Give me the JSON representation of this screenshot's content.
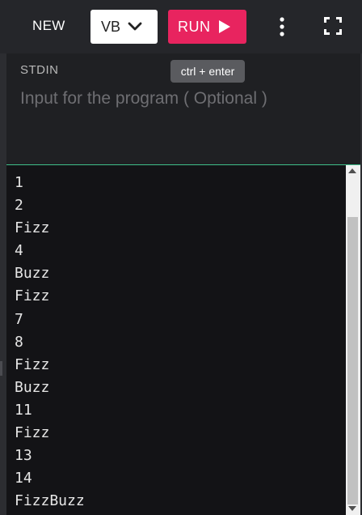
{
  "toolbar": {
    "new_label": "NEW",
    "language": "VB",
    "run_label": "RUN",
    "icons": [
      "chevron-down-icon",
      "play-icon",
      "more-vertical-icon",
      "fullscreen-icon"
    ]
  },
  "tooltip": {
    "text": "ctrl + enter"
  },
  "stdin": {
    "title": "STDIN",
    "value": "",
    "placeholder": "Input for the program ( Optional )"
  },
  "output": {
    "lines": [
      "1",
      "2",
      "Fizz",
      "4",
      "Buzz",
      "Fizz",
      "7",
      "8",
      "Fizz",
      "Buzz",
      "11",
      "Fizz",
      "13",
      "14",
      "FizzBuzz"
    ]
  },
  "colors": {
    "run_button": "#e8245f",
    "divider": "#3fbf8a",
    "background": "#1e1f22",
    "output_background": "#131316"
  }
}
